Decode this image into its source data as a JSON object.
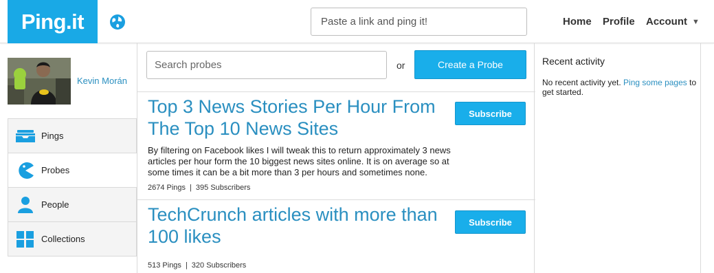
{
  "header": {
    "logo": "Ping.it",
    "ping_placeholder": "Paste a link and ping it!",
    "nav": {
      "home": "Home",
      "profile": "Profile",
      "account": "Account"
    },
    "account_caret": "▼"
  },
  "sidebar": {
    "profile_name": "Kevin Morán",
    "items": [
      {
        "label": "Pings",
        "icon": "inbox-icon"
      },
      {
        "label": "Probes",
        "icon": "pacman-icon"
      },
      {
        "label": "People",
        "icon": "person-icon"
      },
      {
        "label": "Collections",
        "icon": "grid-icon"
      }
    ],
    "active": "Probes"
  },
  "main": {
    "search_placeholder": "Search probes",
    "or": "or",
    "create_label": "Create a Probe",
    "probes": [
      {
        "title": "Top 3 News Stories Per Hour From The Top 10 News Sites",
        "subscribe_label": "Subscribe",
        "description": "By filtering on Facebook likes I will tweak this to return approximately 3 news articles per hour form the 10 biggest news sites online. It is on average so at some times it can be a bit more than 3 per hours and sometimes none.",
        "pings": "2674 Pings",
        "separator": "|",
        "subscribers": "395 Subscribers"
      },
      {
        "title": "TechCrunch articles with more than 100 likes",
        "subscribe_label": "Subscribe",
        "pings": "513 Pings",
        "separator": "|",
        "subscribers": "320 Subscribers"
      }
    ]
  },
  "recent": {
    "title": "Recent activity",
    "text_before": "No recent activity yet. ",
    "link": "Ping some pages",
    "text_after": " to get started."
  },
  "colors": {
    "brand": "#19a9e6",
    "link": "#2a8fc0",
    "button": "#19aeea"
  }
}
